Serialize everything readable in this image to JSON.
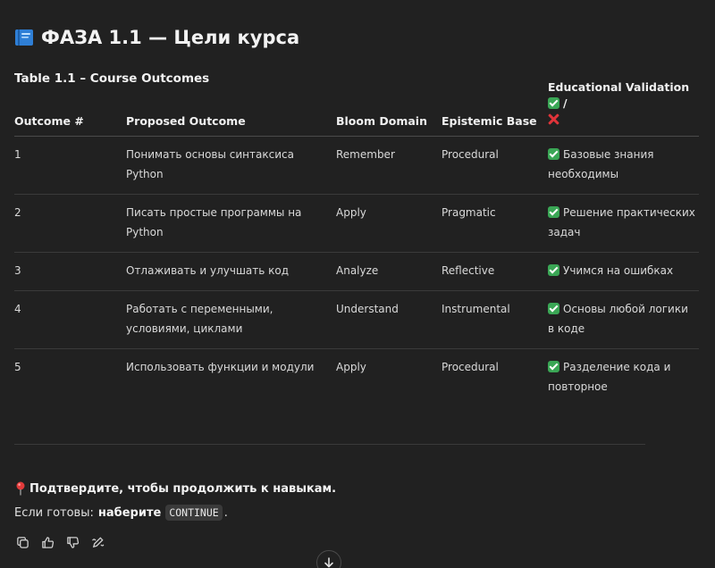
{
  "header": {
    "title": "ФАЗА 1.1 — Цели курса",
    "icon": "blue-book-icon"
  },
  "table": {
    "caption": "Table 1.1 – Course Outcomes",
    "headers": {
      "outcome": "Outcome #",
      "proposed": "Proposed Outcome",
      "bloom": "Bloom Domain",
      "epistemic": "Epistemic Base",
      "validation": "Educational Validation"
    },
    "validation_suffix": "/",
    "rows": [
      {
        "n": "1",
        "outcome": "Понимать основы синтаксиса Python",
        "bloom": "Remember",
        "epistemic": "Procedural",
        "validation": "Базовые знания необходимы"
      },
      {
        "n": "2",
        "outcome": "Писать простые программы на Python",
        "bloom": "Apply",
        "epistemic": "Pragmatic",
        "validation": "Решение практических задач"
      },
      {
        "n": "3",
        "outcome": "Отлаживать и улучшать код",
        "bloom": "Analyze",
        "epistemic": "Reflective",
        "validation": "Учимся на ошибках"
      },
      {
        "n": "4",
        "outcome": "Работать с переменными, условиями, циклами",
        "bloom": "Understand",
        "epistemic": "Instrumental",
        "validation": "Основы любой логики в коде"
      },
      {
        "n": "5",
        "outcome": "Использовать функции и модули",
        "bloom": "Apply",
        "epistemic": "Procedural",
        "validation": "Разделение кода и повторное"
      }
    ]
  },
  "footer": {
    "confirm": "Подтвердите, чтобы продолжить к навыкам.",
    "ready_prefix": "Если готовы:",
    "ready_bold": "наберите",
    "ready_code": "CONTINUE",
    "ready_suffix": "."
  },
  "colors": {
    "background": "#212121",
    "check": "#3aa655",
    "cross": "#e0343a",
    "book": "#2f7fd6"
  },
  "icons": [
    "copy-icon",
    "thumbs-up-icon",
    "thumbs-down-icon",
    "edit-icon",
    "arrow-down-icon",
    "pin-icon",
    "check-icon",
    "cross-icon"
  ]
}
